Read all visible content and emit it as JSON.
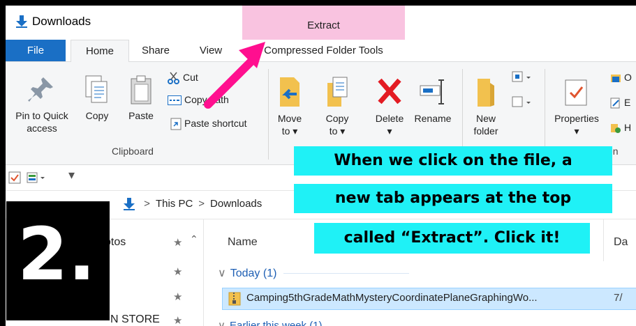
{
  "window": {
    "title": "Downloads",
    "context_tab_header": "Extract"
  },
  "tabs": {
    "file": "File",
    "home": "Home",
    "share": "Share",
    "view": "View",
    "compressed": "Compressed Folder Tools"
  },
  "ribbon": {
    "pin_line1": "Pin to Quick",
    "pin_line2": "access",
    "copy": "Copy",
    "paste": "Paste",
    "cut": "Cut",
    "copy_path": "Copy path",
    "paste_shortcut": "Paste shortcut",
    "clipboard_group": "Clipboard",
    "move_line1": "Move",
    "move_line2": "to ▾",
    "copyto_line1": "Copy",
    "copyto_line2": "to ▾",
    "delete": "Delete",
    "delete_arrow": "▾",
    "rename": "Rename",
    "new_folder_line1": "New",
    "new_folder_line2": "folder",
    "properties": "Properties",
    "properties_arrow": "▾",
    "open_partial": "O",
    "edit_partial": "E",
    "history_partial": "H",
    "open_group_partial": "en"
  },
  "address": {
    "this_pc": "This PC",
    "separator": ">",
    "downloads": "Downloads"
  },
  "nav": {
    "pictures_partial": "otos",
    "store_partial": "N STORE"
  },
  "list": {
    "col_name": "Name",
    "col_date_partial": "Da",
    "group_today": "Today (1)",
    "file_name": "Camping5thGradeMathMysteryCoordinatePlaneGraphingWo...",
    "file_date_partial": "7/",
    "group_earlier": "Earlier this week (1)"
  },
  "overlay": {
    "line1": "When we click on the file, a",
    "line2": "new tab appears at the top",
    "line3": "called “Extract”. Click it!",
    "step_number": "2.",
    "arrow_color": "#ff0f8f",
    "callout_color": "#1ff1f6"
  }
}
